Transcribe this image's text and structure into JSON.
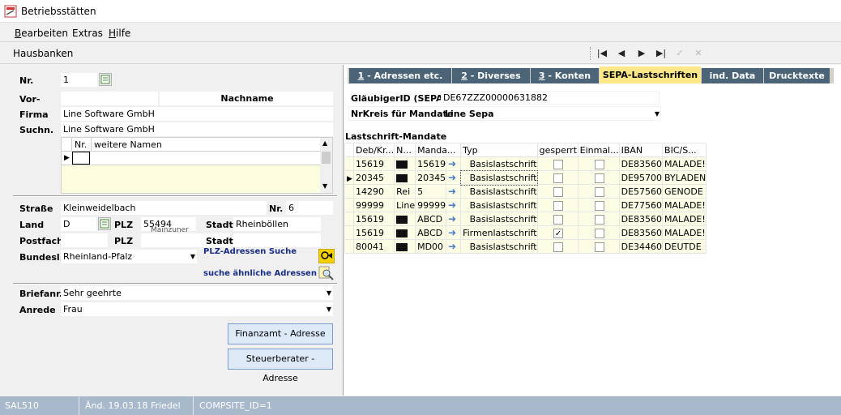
{
  "window": {
    "title": "Betriebsstätten"
  },
  "menu": {
    "items": [
      {
        "label": "Bearbeiten",
        "accel": "B",
        "rest": "earbeiten"
      },
      {
        "label": "Extras",
        "accel": "",
        "rest": "Extras"
      },
      {
        "label": "Hilfe",
        "accel": "H",
        "rest": "ilfe"
      }
    ]
  },
  "toolbar": {
    "title": "Hausbanken",
    "buttons": {
      "first": "|◀",
      "prev": "◀",
      "next": "▶",
      "last": "▶|",
      "confirm": "✓",
      "cancel": "✕"
    }
  },
  "left": {
    "nr_label": "Nr.",
    "nr_value": "1",
    "vor_label": "Vor-",
    "nachname_label": "Nachname",
    "firma_label": "Firma",
    "firma_value": "Line Software GmbH",
    "suchn_label": "Suchn.",
    "suchn_value": "Line Software GmbH",
    "names_grid": {
      "col_nr": "Nr.",
      "col_names": "weitere Namen"
    },
    "strasse_label": "Straße",
    "strasse_value": "Kleinweidelbach",
    "hausnr_label": "Nr.",
    "hausnr_value": "6",
    "land_label": "Land",
    "land_value": "D",
    "plz_label": "PLZ",
    "plz_value": "55494",
    "stadt_label": "Stadt",
    "stadt_value": "Rheinböllen",
    "postfach_label": "Postfach",
    "plz2_label": "PLZ",
    "overlap_text": "Mainzuner",
    "stadt2_label": "Stadt",
    "bundesl_label": "Bundesl.",
    "bundesl_value": "Rheinland-Pfalz",
    "plz_search_link": "PLZ-Adressen Suche",
    "similar_link": "suche ähnliche Adressen",
    "briefanr_label": "Briefanr.",
    "briefanr_value": "Sehr geehrte",
    "anrede_label": "Anrede",
    "anrede_value": "Frau",
    "finanzamt_button": "Finanzamt - Adresse",
    "steuerberater_button": "Steuerberater - Adresse"
  },
  "tabs": [
    {
      "accel": "1",
      "rest": " - Adressen etc.",
      "active": false
    },
    {
      "accel": "2",
      "rest": " - Diverses",
      "active": false
    },
    {
      "accel": "3",
      "rest": " - Konten",
      "active": false
    },
    {
      "accel": "",
      "rest": "SEPA-Lastschriften",
      "active": true
    },
    {
      "accel": "",
      "rest": "ind. Data",
      "active": false
    },
    {
      "accel": "",
      "rest": "Drucktexte",
      "active": false
    }
  ],
  "sepa": {
    "glaeubiger_label": "GläubigerID (SEPA)",
    "glaeubiger_value": "DE67ZZZ00000631882",
    "nrkreis_label": "NrKreis für Mandate",
    "nrkreis_value": "Line Sepa",
    "mandate_title": "Lastschrift-Mandate",
    "columns": [
      "Deb/Kr...",
      "N...",
      "Manda...",
      "Typ",
      "gesperrt",
      "Einmal...",
      "IBAN",
      "BIC/S..."
    ],
    "rows": [
      {
        "deb": "15619",
        "n": "",
        "mandat": "15619",
        "typ": "Basislastschrift",
        "gesperrt": false,
        "einmal": false,
        "iban": "DE83560",
        "bic": "MALADE!",
        "current": false
      },
      {
        "deb": "20345",
        "n": "",
        "mandat": "20345",
        "typ": "Basislastschrift",
        "gesperrt": false,
        "einmal": false,
        "iban": "DE95700",
        "bic": "BYLADEN",
        "current": true
      },
      {
        "deb": "14290",
        "n": "Rei",
        "mandat": "5",
        "typ": "Basislastschrift",
        "gesperrt": false,
        "einmal": false,
        "iban": "DE57560",
        "bic": "GENODE",
        "current": false
      },
      {
        "deb": "99999",
        "n": "Line",
        "mandat": "99999",
        "typ": "Basislastschrift",
        "gesperrt": false,
        "einmal": false,
        "iban": "DE77560",
        "bic": "MALADE!",
        "current": false
      },
      {
        "deb": "15619",
        "n": "",
        "mandat": "ABCD",
        "typ": "Basislastschrift",
        "gesperrt": false,
        "einmal": false,
        "iban": "DE83560",
        "bic": "MALADE!",
        "current": false
      },
      {
        "deb": "15619",
        "n": "",
        "mandat": "ABCD",
        "typ": "Firmenlastschrift",
        "gesperrt": true,
        "einmal": false,
        "iban": "DE83560",
        "bic": "MALADE!",
        "current": false
      },
      {
        "deb": "80041",
        "n": "",
        "mandat": "MD00",
        "typ": "Basislastschrift",
        "gesperrt": false,
        "einmal": false,
        "iban": "DE34460",
        "bic": "DEUTDE",
        "current": false
      }
    ]
  },
  "status": {
    "code": "SAL510",
    "changed": "Änd. 19.03.18 Friedel",
    "composite": "COMPSITE_ID=1"
  }
}
